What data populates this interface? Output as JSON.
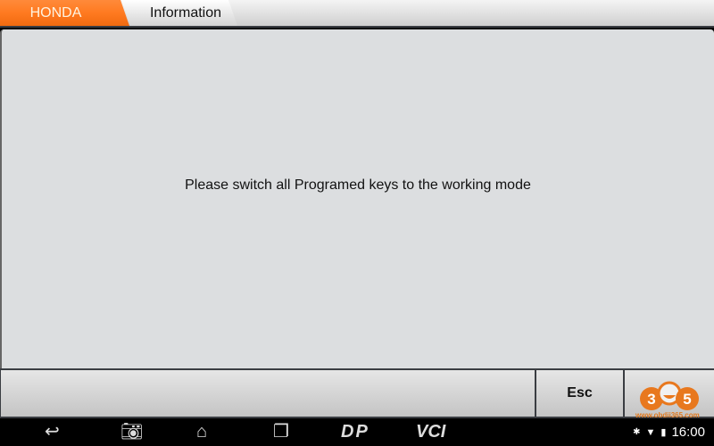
{
  "header": {
    "tabs": [
      {
        "label": "HONDA",
        "active": true
      },
      {
        "label": "Information"
      }
    ]
  },
  "main": {
    "message": "Please switch all Programed keys to the working mode"
  },
  "buttons": {
    "esc_label": "Esc"
  },
  "logo": {
    "text": "365",
    "watermark": "www.obdii365.com"
  },
  "navbar": {
    "icons": [
      "back-icon",
      "camera-icon",
      "home-icon",
      "recent-apps-icon",
      "dp-icon",
      "vci-icon"
    ],
    "dp_label": "DP",
    "vci_label": "VCI"
  },
  "status": {
    "time": "16:00",
    "icons": [
      "bluetooth-icon",
      "wifi-icon",
      "battery-icon"
    ]
  },
  "colors": {
    "accent": "#ff7a20",
    "background": "#dcdee0"
  }
}
